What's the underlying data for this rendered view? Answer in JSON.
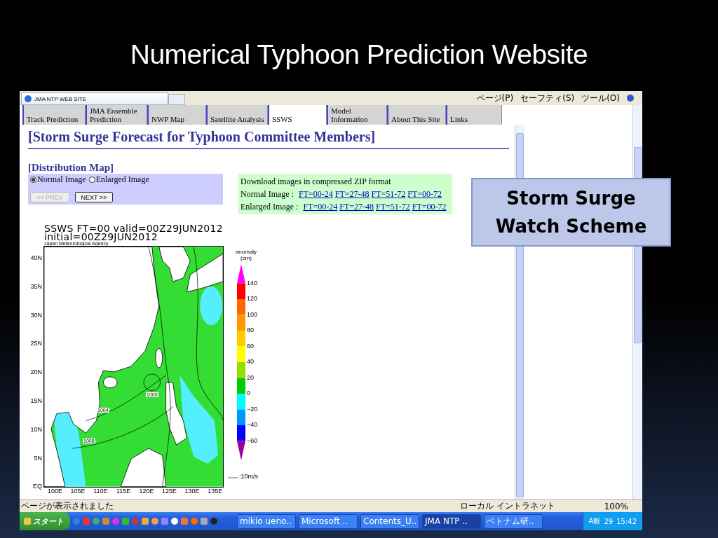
{
  "slide": {
    "title": "Numerical Typhoon Prediction Website",
    "callout": "Storm Surge Watch Scheme"
  },
  "browser": {
    "tab_title": "JMA NTP WEB SITE",
    "toolbar": [
      "ページ(P)",
      "セーフティ(S)",
      "ツール(O)"
    ]
  },
  "nav_tabs": [
    {
      "label": "Track Prediction",
      "selected": false
    },
    {
      "label": "JMA Ensemble Prediction",
      "selected": false
    },
    {
      "label": "NWP Map",
      "selected": false
    },
    {
      "label": "Satellite Analysis",
      "selected": false
    },
    {
      "label": "SSWS",
      "selected": true
    },
    {
      "label": "Model Information",
      "selected": false
    },
    {
      "label": "About This Site",
      "selected": false
    },
    {
      "label": "Links",
      "selected": false
    }
  ],
  "page": {
    "heading": "[Storm Surge Forecast for Typhoon Committee Members]",
    "subheading": "[Distribution Map]",
    "radios": [
      {
        "label": "Normal Image",
        "selected": true
      },
      {
        "label": "Enlarged Image",
        "selected": false
      }
    ],
    "buttons": [
      {
        "label": "<< PREV",
        "disabled": true
      },
      {
        "label": "NEXT >>",
        "disabled": false
      }
    ],
    "download": {
      "title": "Download images in compressed ZIP format",
      "rows": [
        {
          "label": "Normal Image :",
          "links": [
            "FT=00-24",
            "FT=27-48",
            "FT=51-72",
            "FT=00-72"
          ]
        },
        {
          "label": "Enlarged Image :",
          "links": [
            "FT=00-24",
            "FT=27-48",
            "FT=51-72",
            "FT=00-72"
          ]
        }
      ]
    }
  },
  "map": {
    "title": "SSWS  FT=00  valid=00Z29JUN2012",
    "subtitle": "initial=00Z29JUN2012",
    "agency": "Japan Meteorological Agency",
    "lat_labels": [
      "40N",
      "35N",
      "30N",
      "25N",
      "20N",
      "15N",
      "10N",
      "5N",
      "EQ"
    ],
    "lon_labels": [
      "100E",
      "105E",
      "110E",
      "115E",
      "120E",
      "125E",
      "130E",
      "135E"
    ],
    "contour_labels": [
      "1000",
      "1004",
      "1008"
    ],
    "legend_title": "anomaly (cm)",
    "legend_colors": [
      {
        "color": "#ff00ff"
      },
      {
        "color": "#ff0000"
      },
      {
        "color": "#ff6600"
      },
      {
        "color": "#ff9900"
      },
      {
        "color": "#ffcc00"
      },
      {
        "color": "#ffff00"
      },
      {
        "color": "#99dd00"
      },
      {
        "color": "#00cc00"
      },
      {
        "color": "#00ffff"
      },
      {
        "color": "#0099ff"
      },
      {
        "color": "#0000ff"
      },
      {
        "color": "#990099"
      }
    ],
    "legend_labels": [
      "140",
      "120",
      "100",
      "80",
      "60",
      "40",
      "20",
      "0",
      "−20",
      "−40",
      "−60"
    ],
    "wind_scale": ":10m/s"
  },
  "status_bar": {
    "text": "ページが表示されました",
    "zone": "ローカル イントラネット",
    "zoom": "100%"
  },
  "taskbar": {
    "start": "スタート",
    "tasks": [
      {
        "label": "mikio ueno..",
        "selected": false
      },
      {
        "label": "Microsoft ..",
        "selected": false
      },
      {
        "label": "Contents_U..",
        "selected": false
      },
      {
        "label": "JMA NTP ..",
        "selected": true
      },
      {
        "label": "ベトナム研..",
        "selected": false
      }
    ],
    "ime": "A般",
    "date": "29",
    "clock": "15:42"
  }
}
